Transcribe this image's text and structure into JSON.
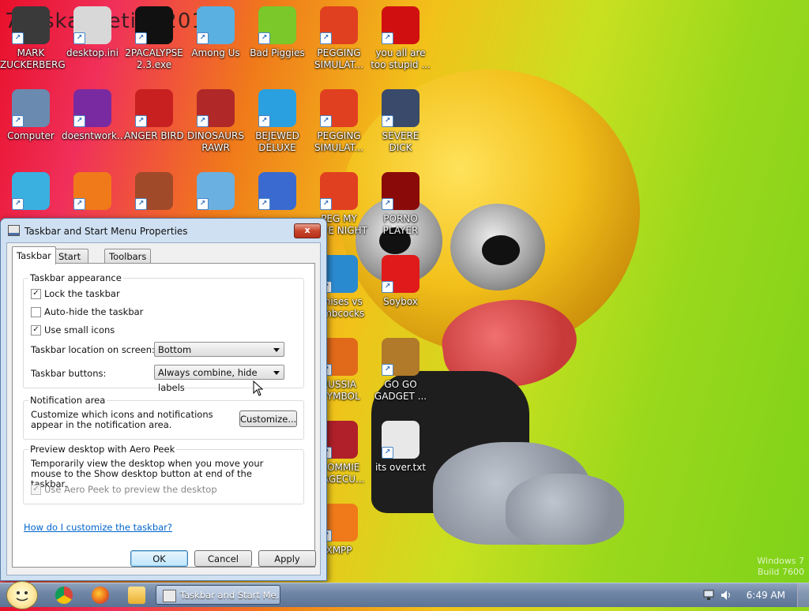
{
  "wallpaper": {
    "title_text": "7osskanaetion2012",
    "watermark_line1": "Windows 7",
    "watermark_line2": "Build 7600"
  },
  "desktop_icons": [
    {
      "label": "MARK ZUCKERBERG",
      "icon": "person-icon",
      "color": "#3a3a3a"
    },
    {
      "label": "desktop.ini",
      "icon": "settings-file-icon",
      "color": "#d8d8d8"
    },
    {
      "label": "2PACALYPSE 2.3.exe",
      "icon": "console-icon",
      "color": "#111111"
    },
    {
      "label": "Among Us",
      "icon": "game-icon",
      "color": "#5ab0e0"
    },
    {
      "label": "Bad Piggies",
      "icon": "pig-icon",
      "color": "#7ac82a"
    },
    {
      "label": "PEGGING SIMULAT...",
      "icon": "peggle-icon",
      "color": "#e04020"
    },
    {
      "label": "you all are too stupid ...",
      "icon": "devcpp-icon",
      "color": "#d01010"
    },
    {
      "label": "Computer",
      "icon": "computer-icon",
      "color": "#6a8ab0"
    },
    {
      "label": "doesntwork...",
      "icon": "yahoo-icon",
      "color": "#7a2aa0"
    },
    {
      "label": "ANGER BIRD",
      "icon": "angry-bird-icon",
      "color": "#c82020"
    },
    {
      "label": "DINOSAURS RAWR",
      "icon": "angry-bird-icon",
      "color": "#b02828"
    },
    {
      "label": "BEJEWED DELUXE",
      "icon": "gem-icon",
      "color": "#2aa0e0"
    },
    {
      "label": "PEGGING SIMULAT...",
      "icon": "peggle-icon",
      "color": "#e04020"
    },
    {
      "label": "SEVERE DICK",
      "icon": "sd-icon",
      "color": "#3a4a6a"
    },
    {
      "label": "",
      "icon": "network-icon",
      "color": "#3ab0e0"
    },
    {
      "label": "",
      "icon": "firefox-icon",
      "color": "#f07a1a"
    },
    {
      "label": "",
      "icon": "angry-bird-icon",
      "color": "#a04a2a"
    },
    {
      "label": "",
      "icon": "game-icon",
      "color": "#6ab0e0"
    },
    {
      "label": "",
      "icon": "bejeweled2-icon",
      "color": "#3a6ad0"
    },
    {
      "label": "PEG MY WIFE NIGHT",
      "icon": "peggle-icon",
      "color": "#e04020"
    },
    {
      "label": "PORNO PLAYER",
      "icon": "flash-icon",
      "color": "#8a0a0a"
    },
    {
      "label": "...nises vs ...mbcocks",
      "icon": "game-icon",
      "color": "#2a8ad0"
    },
    {
      "label": "Soybox",
      "icon": "soybox-icon",
      "color": "#e01a1a"
    },
    {
      "label": "RUSSIA ...YMBOL",
      "icon": "game-icon",
      "color": "#e06a1a"
    },
    {
      "label": "GO GO GADGET ...",
      "icon": "briefcase-icon",
      "color": "#b07a2a"
    },
    {
      "label": "...OMMIE ...AGECU...",
      "icon": "game-icon",
      "color": "#b0202a"
    },
    {
      "label": "its over.txt",
      "icon": "text-file-icon",
      "color": "#e8e8e8"
    },
    {
      "label": "XMPP",
      "icon": "xampp-icon",
      "color": "#f07a1a"
    }
  ],
  "dialog": {
    "title": "Taskbar and Start Menu Properties",
    "close_label": "x",
    "tabs": [
      "Taskbar",
      "Start Menu",
      "Toolbars"
    ],
    "appearance": {
      "heading": "Taskbar appearance",
      "lock": {
        "label": "Lock the taskbar",
        "checked": true
      },
      "autohide": {
        "label": "Auto-hide the taskbar",
        "checked": false
      },
      "small_icons": {
        "label": "Use small icons",
        "checked": true
      },
      "location_label": "Taskbar location on screen:",
      "location_value": "Bottom",
      "buttons_label": "Taskbar buttons:",
      "buttons_value": "Always combine, hide labels"
    },
    "notification": {
      "heading": "Notification area",
      "text": "Customize which icons and notifications appear in the notification area.",
      "button": "Customize..."
    },
    "peek": {
      "heading": "Preview desktop with Aero Peek",
      "text": "Temporarily view the desktop when you move your mouse to the Show desktop button at end of the taskbar.",
      "checkbox_label": "Use Aero Peek to preview the desktop",
      "checked": true,
      "disabled": true
    },
    "help_link": "How do I customize the taskbar?",
    "buttons": {
      "ok": "OK",
      "cancel": "Cancel",
      "apply": "Apply"
    }
  },
  "taskbar": {
    "active_task": "Taskbar and Start Me...",
    "pinned": [
      "chrome-icon",
      "firefox-icon",
      "folder-icon"
    ],
    "clock": "6:49 AM"
  }
}
